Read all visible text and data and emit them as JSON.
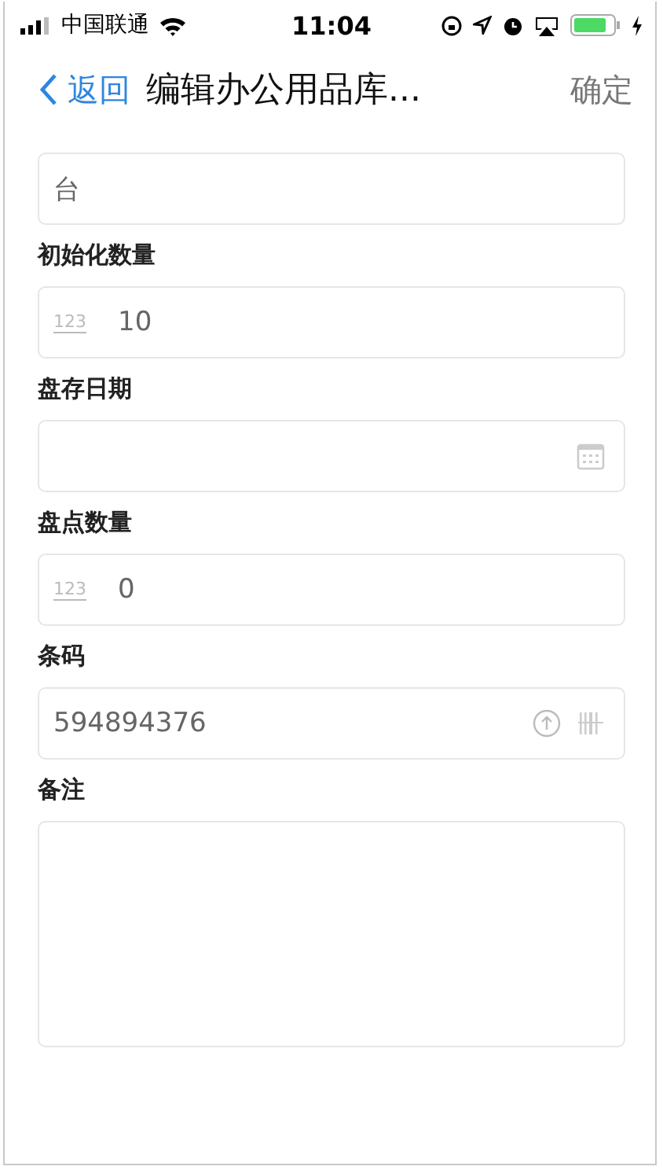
{
  "status_bar": {
    "carrier": "中国联通",
    "time": "11:04"
  },
  "nav": {
    "back": "返回",
    "title": "编辑办公用品库...",
    "confirm": "确定"
  },
  "fields": [
    {
      "kind": "text",
      "value": "台"
    },
    {
      "kind": "number",
      "label": "初始化数量",
      "prefix": "123",
      "value": "10"
    },
    {
      "kind": "date",
      "label": "盘存日期"
    },
    {
      "kind": "number",
      "label": "盘点数量",
      "prefix": "123",
      "value": "0"
    },
    {
      "kind": "barcode",
      "label": "条码",
      "value": "594894376"
    },
    {
      "kind": "textarea",
      "label": "备注"
    }
  ]
}
